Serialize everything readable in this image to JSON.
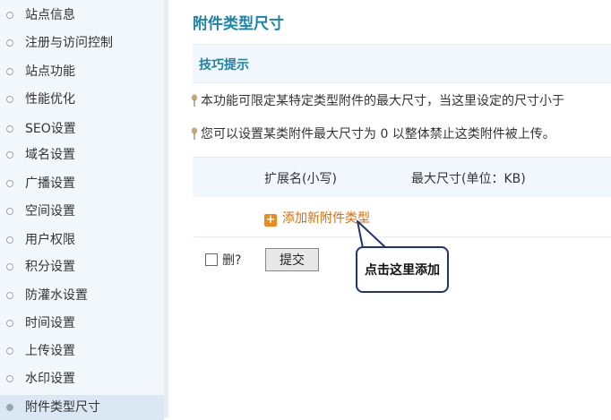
{
  "sidebar": {
    "items": [
      {
        "label": "站点信息"
      },
      {
        "label": "注册与访问控制"
      },
      {
        "label": "站点功能"
      },
      {
        "label": "性能优化"
      },
      {
        "label": "SEO设置"
      },
      {
        "label": "域名设置"
      },
      {
        "label": "广播设置"
      },
      {
        "label": "空间设置"
      },
      {
        "label": "用户权限"
      },
      {
        "label": "积分设置"
      },
      {
        "label": "防灌水设置"
      },
      {
        "label": "时间设置"
      },
      {
        "label": "上传设置"
      },
      {
        "label": "水印设置"
      },
      {
        "label": "附件类型尺寸"
      }
    ],
    "active_index": 14
  },
  "main": {
    "title": "附件类型尺寸",
    "tips_title": "技巧提示",
    "tips": [
      "本功能可限定某特定类型附件的最大尺寸，当这里设定的尺寸小于",
      "您可以设置某类附件最大尺寸为 0 以整体禁止这类附件被上传。"
    ],
    "table": {
      "col_ext": "扩展名(小写)",
      "col_size": "最大尺寸(单位：KB)"
    },
    "add_label": "添加新附件类型",
    "delete_label": "删?",
    "submit_label": "提交"
  },
  "callout": {
    "text": "点击这里添加"
  },
  "colors": {
    "title": "#1a83a8",
    "link": "#e66a00",
    "callout_border": "#22327a"
  }
}
